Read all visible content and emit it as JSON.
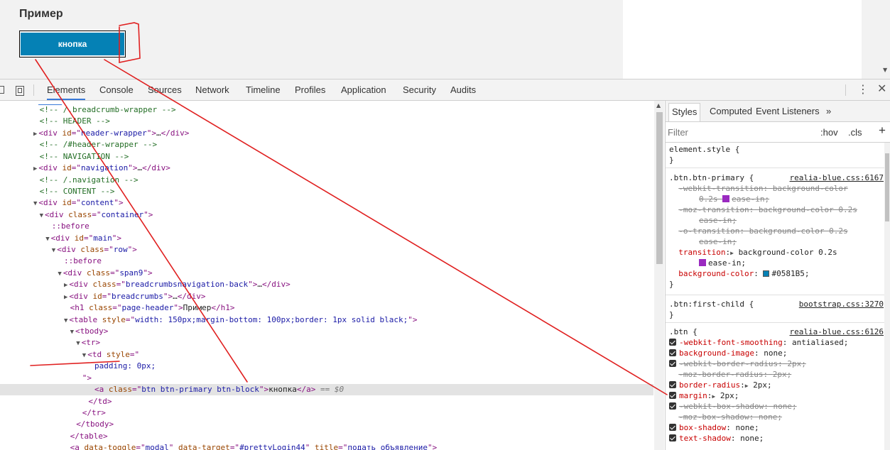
{
  "preview": {
    "title": "Пример",
    "button_label": "кнопка"
  },
  "devtools": {
    "tabs": [
      {
        "label": "Elements",
        "active": true
      },
      {
        "label": "Console"
      },
      {
        "label": "Sources"
      },
      {
        "label": "Network"
      },
      {
        "label": "Timeline"
      },
      {
        "label": "Profiles"
      },
      {
        "label": "Application"
      },
      {
        "label": "Security"
      },
      {
        "label": "Audits"
      }
    ],
    "icons": [
      "inspect-icon",
      "device-toolbar-icon",
      "more-menu-icon",
      "close-icon"
    ]
  },
  "elements": {
    "lines": [
      {
        "indent": 6,
        "parts": [
          {
            "c": "cm",
            "t": "<!-- /.breadcrumb-wrapper -->"
          }
        ]
      },
      {
        "indent": 6,
        "parts": [
          {
            "c": "cm",
            "t": "<!-- HEADER -->"
          }
        ]
      },
      {
        "indent": 5,
        "arrow": "▶",
        "parts": [
          {
            "c": "tg",
            "t": "<div "
          },
          {
            "c": "an",
            "t": "id"
          },
          {
            "c": "tg",
            "t": "=\""
          },
          {
            "c": "av",
            "t": "header-wrapper"
          },
          {
            "c": "tg",
            "t": "\">"
          },
          {
            "c": "tx",
            "t": "…"
          },
          {
            "c": "tg",
            "t": "</div>"
          }
        ]
      },
      {
        "indent": 6,
        "parts": [
          {
            "c": "cm",
            "t": "<!-- /#header-wrapper -->"
          }
        ]
      },
      {
        "indent": 6,
        "parts": [
          {
            "c": "cm",
            "t": "<!-- NAVIGATION -->"
          }
        ]
      },
      {
        "indent": 5,
        "arrow": "▶",
        "parts": [
          {
            "c": "tg",
            "t": "<div "
          },
          {
            "c": "an",
            "t": "id"
          },
          {
            "c": "tg",
            "t": "=\""
          },
          {
            "c": "av",
            "t": "navigation"
          },
          {
            "c": "tg",
            "t": "\">"
          },
          {
            "c": "tx",
            "t": "…"
          },
          {
            "c": "tg",
            "t": "</div>"
          }
        ]
      },
      {
        "indent": 6,
        "parts": [
          {
            "c": "cm",
            "t": "<!-- /.navigation -->"
          }
        ]
      },
      {
        "indent": 6,
        "parts": [
          {
            "c": "cm",
            "t": "<!-- CONTENT -->"
          }
        ]
      },
      {
        "indent": 5,
        "arrow": "▼",
        "parts": [
          {
            "c": "tg",
            "t": "<div "
          },
          {
            "c": "an",
            "t": "id"
          },
          {
            "c": "tg",
            "t": "=\""
          },
          {
            "c": "av",
            "t": "content"
          },
          {
            "c": "tg",
            "t": "\">"
          }
        ]
      },
      {
        "indent": 6,
        "arrow": "▼",
        "parts": [
          {
            "c": "tg",
            "t": "<div "
          },
          {
            "c": "an",
            "t": "class"
          },
          {
            "c": "tg",
            "t": "=\""
          },
          {
            "c": "av",
            "t": "container"
          },
          {
            "c": "tg",
            "t": "\">"
          }
        ]
      },
      {
        "indent": 8,
        "parts": [
          {
            "c": "tg",
            "t": "::before"
          }
        ]
      },
      {
        "indent": 7,
        "arrow": "▼",
        "parts": [
          {
            "c": "tg",
            "t": "<div "
          },
          {
            "c": "an",
            "t": "id"
          },
          {
            "c": "tg",
            "t": "=\""
          },
          {
            "c": "av",
            "t": "main"
          },
          {
            "c": "tg",
            "t": "\">"
          }
        ]
      },
      {
        "indent": 8,
        "arrow": "▼",
        "parts": [
          {
            "c": "tg",
            "t": "<div "
          },
          {
            "c": "an",
            "t": "class"
          },
          {
            "c": "tg",
            "t": "=\""
          },
          {
            "c": "av",
            "t": "row"
          },
          {
            "c": "tg",
            "t": "\">"
          }
        ]
      },
      {
        "indent": 10,
        "parts": [
          {
            "c": "tg",
            "t": "::before"
          }
        ]
      },
      {
        "indent": 9,
        "arrow": "▼",
        "parts": [
          {
            "c": "tg",
            "t": "<div "
          },
          {
            "c": "an",
            "t": "class"
          },
          {
            "c": "tg",
            "t": "=\""
          },
          {
            "c": "av",
            "t": "span9"
          },
          {
            "c": "tg",
            "t": "\">"
          }
        ]
      },
      {
        "indent": 10,
        "arrow": "▶",
        "parts": [
          {
            "c": "tg",
            "t": "<div "
          },
          {
            "c": "an",
            "t": "class"
          },
          {
            "c": "tg",
            "t": "=\""
          },
          {
            "c": "av",
            "t": "breadcrumbsnavigation-back"
          },
          {
            "c": "tg",
            "t": "\">"
          },
          {
            "c": "tx",
            "t": "…"
          },
          {
            "c": "tg",
            "t": "</div>"
          }
        ]
      },
      {
        "indent": 10,
        "arrow": "▶",
        "parts": [
          {
            "c": "tg",
            "t": "<div "
          },
          {
            "c": "an",
            "t": "id"
          },
          {
            "c": "tg",
            "t": "=\""
          },
          {
            "c": "av",
            "t": "breadcrumbs"
          },
          {
            "c": "tg",
            "t": "\">"
          },
          {
            "c": "tx",
            "t": "…"
          },
          {
            "c": "tg",
            "t": "</div>"
          }
        ]
      },
      {
        "indent": 11,
        "parts": [
          {
            "c": "tg",
            "t": "<h1 "
          },
          {
            "c": "an",
            "t": "class"
          },
          {
            "c": "tg",
            "t": "=\""
          },
          {
            "c": "av",
            "t": "page-header"
          },
          {
            "c": "tg",
            "t": "\">"
          },
          {
            "c": "tx",
            "t": "Пример"
          },
          {
            "c": "tg",
            "t": "</h1>"
          }
        ]
      },
      {
        "indent": 10,
        "arrow": "▼",
        "parts": [
          {
            "c": "tg",
            "t": "<table "
          },
          {
            "c": "an",
            "t": "style"
          },
          {
            "c": "tg",
            "t": "=\""
          },
          {
            "c": "av",
            "t": "width: 150px;margin-bottom: 100px;border: 1px solid black;"
          },
          {
            "c": "tg",
            "t": "\">"
          }
        ]
      },
      {
        "indent": 11,
        "arrow": "▼",
        "parts": [
          {
            "c": "tg",
            "t": "<tbody>"
          }
        ]
      },
      {
        "indent": 12,
        "arrow": "▼",
        "parts": [
          {
            "c": "tg",
            "t": "<tr>"
          }
        ]
      },
      {
        "indent": 13,
        "arrow": "▼",
        "parts": [
          {
            "c": "tg",
            "t": "<td "
          },
          {
            "c": "an",
            "t": "style"
          },
          {
            "c": "tg",
            "t": "=\""
          }
        ]
      },
      {
        "indent": 15,
        "parts": [
          {
            "c": "av",
            "t": "padding: 0px;"
          }
        ]
      },
      {
        "indent": 13,
        "parts": [
          {
            "c": "tg",
            "t": "\">"
          }
        ]
      },
      {
        "indent": 15,
        "selected": true,
        "parts": [
          {
            "c": "tg",
            "t": "<a "
          },
          {
            "c": "an",
            "t": "class"
          },
          {
            "c": "tg",
            "t": "=\""
          },
          {
            "c": "av",
            "t": "btn btn-primary btn-block"
          },
          {
            "c": "tg",
            "t": "\">"
          },
          {
            "c": "tx",
            "t": "кнопка"
          },
          {
            "c": "tg",
            "t": "</a>"
          },
          {
            "c": "eq",
            "t": " == $0"
          }
        ]
      },
      {
        "indent": 14,
        "parts": [
          {
            "c": "tg",
            "t": "</td>"
          }
        ]
      },
      {
        "indent": 13,
        "parts": [
          {
            "c": "tg",
            "t": "</tr>"
          }
        ]
      },
      {
        "indent": 12,
        "parts": [
          {
            "c": "tg",
            "t": "</tbody>"
          }
        ]
      },
      {
        "indent": 11,
        "parts": [
          {
            "c": "tg",
            "t": "</table>"
          }
        ]
      },
      {
        "indent": 11,
        "parts": [
          {
            "c": "tg",
            "t": "<a "
          },
          {
            "c": "an",
            "t": "data-toggle"
          },
          {
            "c": "tg",
            "t": "=\""
          },
          {
            "c": "av",
            "t": "modal"
          },
          {
            "c": "tg",
            "t": "\" "
          },
          {
            "c": "an",
            "t": "data-target"
          },
          {
            "c": "tg",
            "t": "=\""
          },
          {
            "c": "av",
            "t": "#prettyLogin44"
          },
          {
            "c": "tg",
            "t": "\" "
          },
          {
            "c": "an",
            "t": "title"
          },
          {
            "c": "tg",
            "t": "=\""
          },
          {
            "c": "av",
            "t": "подать объявление"
          },
          {
            "c": "tg",
            "t": "\">"
          }
        ]
      }
    ]
  },
  "sidebar": {
    "tabs": [
      {
        "label": "Styles",
        "active": true
      },
      {
        "label": "Computed"
      },
      {
        "label": "Event Listeners"
      },
      {
        "label": "»"
      }
    ],
    "filter_placeholder": "Filter",
    "hov": ":hov",
    "cls": ".cls",
    "add": "+",
    "rules": [
      {
        "selector": "element.style {",
        "lines": [
          "}"
        ]
      },
      {
        "selector": ".btn.btn-primary {",
        "source": "realia-blue.css:6167",
        "decls": [
          {
            "name": "-webkit-transition",
            "value": "background-color",
            "strike": true
          },
          {
            "cont": "0.2s",
            "ease": "ease-in;",
            "strike": true
          },
          {
            "name": "-moz-transition",
            "value": "background-color 0.2s",
            "strike": true,
            "indent": true
          },
          {
            "cont": "ease-in;",
            "strike": true,
            "indent": true
          },
          {
            "name": "-o-transition",
            "value": "background-color 0.2s",
            "strike": true,
            "indent": true
          },
          {
            "cont": "ease-in;",
            "strike": true,
            "indent": true
          },
          {
            "name": "transition",
            "value": "background-color 0.2s",
            "tri": true
          },
          {
            "cont": "ease-in;",
            "ease_icon": true
          },
          {
            "name": "background-color",
            "value": "#0581B5",
            "swatch": "#0581B5"
          }
        ],
        "close": "}"
      },
      {
        "selector": ".btn:first-child {",
        "source": "bootstrap.css:3270",
        "close": "}"
      },
      {
        "selector": ".btn {",
        "source": "realia-blue.css:6126",
        "decls": [
          {
            "name": "-webkit-font-smoothing",
            "value": "antialiased;",
            "check": true
          },
          {
            "name": "background-image",
            "value": "none;",
            "check": true
          },
          {
            "name": "-webkit-border-radius",
            "value": "2px;",
            "check": true,
            "strike": true
          },
          {
            "name": "-moz-border-radius",
            "value": "2px;",
            "strike": true
          },
          {
            "name": "border-radius",
            "value": "2px;",
            "check": true,
            "tri": true
          },
          {
            "name": "margin",
            "value": "2px;",
            "check": true,
            "tri": true
          },
          {
            "name": "-webkit-box-shadow",
            "value": "none;",
            "check": true,
            "strike": true
          },
          {
            "name": "-moz-box-shadow",
            "value": "none;",
            "strike": true
          },
          {
            "name": "box-shadow",
            "value": "none;",
            "check": true
          },
          {
            "name": "text-shadow",
            "value": "none;",
            "check": true
          }
        ]
      }
    ]
  },
  "colors": {
    "button": "#0581B5",
    "annotation": "#e02020",
    "tab_underline": "#3879d9"
  }
}
